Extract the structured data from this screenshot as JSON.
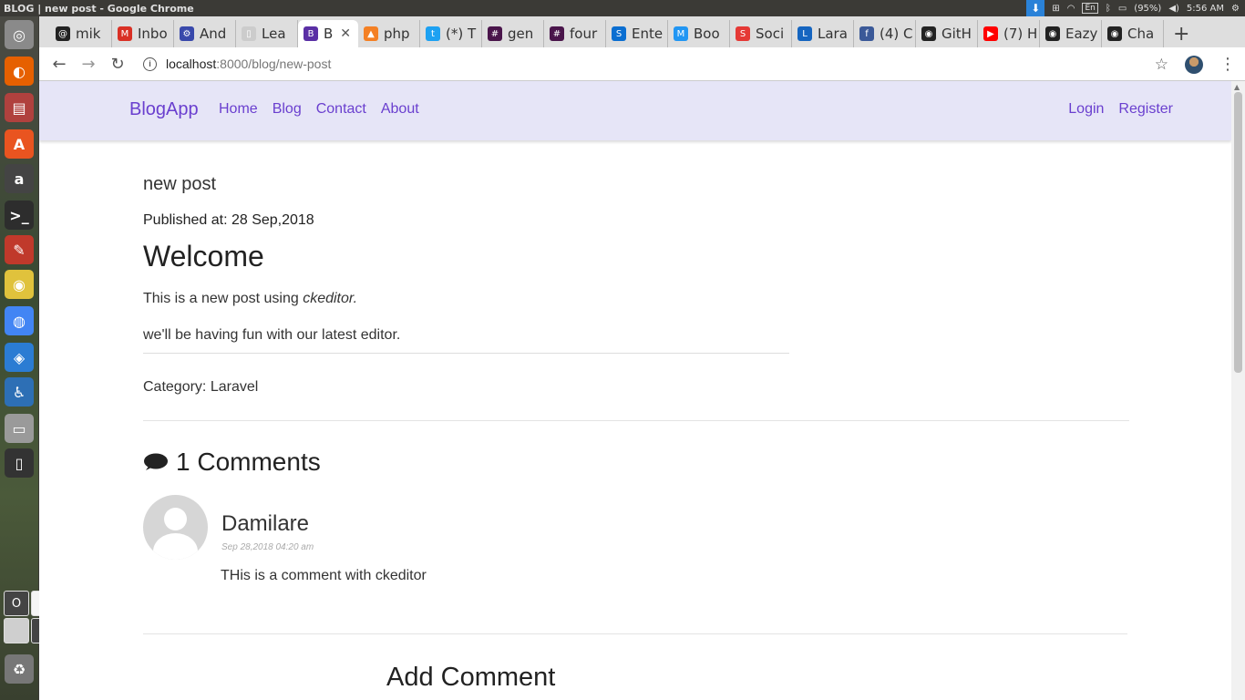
{
  "os": {
    "window_title": "BLOG | new post - Google Chrome",
    "keyboard": "En",
    "battery": "(95%)",
    "clock": "5:56 AM",
    "launcher_items": [
      "dash-icon",
      "firefox-icon",
      "files-icon",
      "software-center-icon",
      "amazon-icon",
      "terminal-icon",
      "settings-icon",
      "disk-icon",
      "chrome-icon",
      "vscode-icon",
      "accessibility-icon",
      "drive-icon",
      "phone-icon",
      "trash-icon"
    ],
    "workspaces": [
      "O",
      "",
      "",
      "B"
    ]
  },
  "browser": {
    "tabs": [
      {
        "label": "mik",
        "icon": "@",
        "color": "#222222"
      },
      {
        "label": "Inbo",
        "icon": "M",
        "color": "#d93025"
      },
      {
        "label": "And",
        "icon": "⚙",
        "color": "#3949ab"
      },
      {
        "label": "Lea",
        "icon": "▯",
        "color": "#cccccc"
      },
      {
        "label": "B",
        "icon": "B",
        "color": "#5a2fa5",
        "active": true
      },
      {
        "label": "php",
        "icon": "▲",
        "color": "#f48024"
      },
      {
        "label": "(*) T",
        "icon": "t",
        "color": "#1da1f2"
      },
      {
        "label": "gen",
        "icon": "#",
        "color": "#4a154b"
      },
      {
        "label": "four",
        "icon": "#",
        "color": "#4a154b"
      },
      {
        "label": "Ente",
        "icon": "S",
        "color": "#0a6ed1"
      },
      {
        "label": "Boo",
        "icon": "M",
        "color": "#2196f3"
      },
      {
        "label": "Soci",
        "icon": "S",
        "color": "#e53935"
      },
      {
        "label": "Lara",
        "icon": "L",
        "color": "#1565c0"
      },
      {
        "label": "(4) C",
        "icon": "f",
        "color": "#3b5998"
      },
      {
        "label": "GitH",
        "icon": "◉",
        "color": "#222222"
      },
      {
        "label": "(7) H",
        "icon": "▶",
        "color": "#ff0000"
      },
      {
        "label": "Eazy",
        "icon": "◉",
        "color": "#222222"
      },
      {
        "label": "Cha",
        "icon": "◉",
        "color": "#222222"
      }
    ],
    "url_host": "localhost",
    "url_path": ":8000/blog/new-post"
  },
  "site": {
    "brand": "BlogApp",
    "nav": [
      "Home",
      "Blog",
      "Contact",
      "About"
    ],
    "nav_right": [
      "Login",
      "Register"
    ],
    "accent": "#6a3fcf"
  },
  "post": {
    "title": "new post",
    "published": "Published at: 28 Sep,2018",
    "heading": "Welcome",
    "p1_prefix": "This is a new post using ",
    "p1_em": "ckeditor.",
    "p2": "we'll be having fun with our latest editor.",
    "category": "Category: Laravel"
  },
  "comments": {
    "header": "1 Comments",
    "items": [
      {
        "author": "Damilare",
        "date": "Sep 28,2018 04:20 am",
        "text": "THis is a comment with ckeditor"
      }
    ],
    "add_title": "Add Comment"
  }
}
